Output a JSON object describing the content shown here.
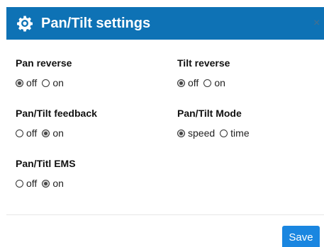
{
  "header": {
    "title": "Pan/Tilt settings",
    "icon": "gear-icon",
    "close_glyph": "×",
    "background": "#0e72b5"
  },
  "fields": {
    "pan_reverse": {
      "label": "Pan reverse",
      "options": [
        {
          "label": "off",
          "selected": true
        },
        {
          "label": "on",
          "selected": false
        }
      ]
    },
    "tilt_reverse": {
      "label": "Tilt reverse",
      "options": [
        {
          "label": "off",
          "selected": true
        },
        {
          "label": "on",
          "selected": false
        }
      ]
    },
    "pan_tilt_feedback": {
      "label": "Pan/Tilt feedback",
      "options": [
        {
          "label": "off",
          "selected": false
        },
        {
          "label": "on",
          "selected": true
        }
      ]
    },
    "pan_tilt_mode": {
      "label": "Pan/Tilt Mode",
      "options": [
        {
          "label": "speed",
          "selected": true
        },
        {
          "label": "time",
          "selected": false
        }
      ]
    },
    "pan_titl_ems": {
      "label": "Pan/Titl EMS",
      "options": [
        {
          "label": "off",
          "selected": false
        },
        {
          "label": "on",
          "selected": true
        }
      ]
    }
  },
  "footer": {
    "save_label": "Save",
    "save_color": "#1a86e0"
  }
}
